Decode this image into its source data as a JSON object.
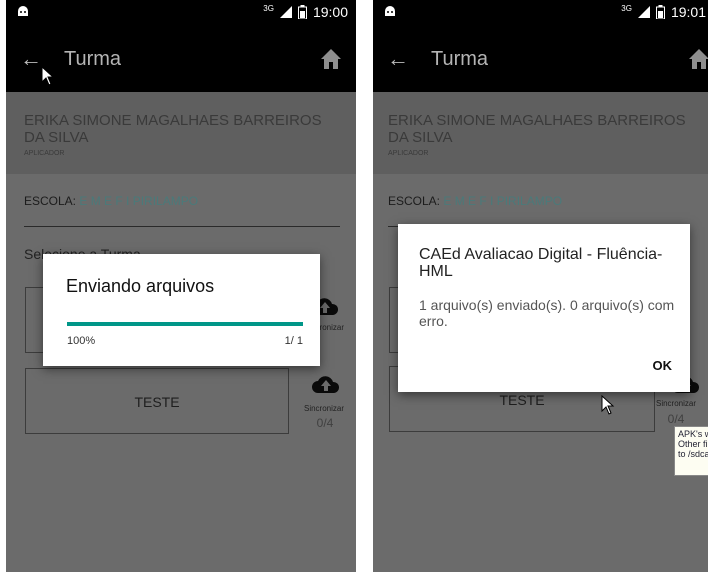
{
  "screens": [
    {
      "status_time": "19:00",
      "status_network": "3G",
      "title": "Turma",
      "user_name": "ERIKA SIMONE MAGALHAES BARREIROS DA SILVA",
      "user_role": "APLICADOR",
      "escola_label": "ESCOLA:",
      "escola_value": "E M E F I PIRILAMPO",
      "select_label": "Selecione a Turma",
      "turmas": [
        {
          "label": "",
          "sync_label": "Sincronizar",
          "sync_count": "0/4"
        },
        {
          "label": "TESTE",
          "sync_label": "Sincronizar",
          "sync_count": "0/4"
        }
      ],
      "progress_dialog": {
        "title": "Enviando arquivos",
        "percent_label": "100%",
        "count_label": "1/ 1",
        "progress": 1.0
      }
    },
    {
      "status_time": "19:01",
      "status_network": "3G",
      "title": "Turma",
      "user_name": "ERIKA SIMONE MAGALHAES BARREIROS DA SILVA",
      "user_role": "APLICADOR",
      "escola_label": "ESCOLA:",
      "escola_value": "E M E F I PIRILAMPO",
      "turmas": [
        {
          "label": "",
          "sync_label": "Sincronizar",
          "sync_count": ""
        },
        {
          "label": "TESTE",
          "sync_label": "Sincronizar",
          "sync_count": "0/4"
        }
      ],
      "alert_dialog": {
        "title": "CAEd Avaliacao Digital - Fluência-HML",
        "message": "1 arquivo(s) enviado(s). 0 arquivo(s) com erro.",
        "ok_label": "OK"
      },
      "tooltip": [
        "APK's w",
        "Other fi",
        "to /sdca"
      ]
    }
  ],
  "colors": {
    "appbar": "#000000",
    "screen_dim": "#6b6b6b",
    "progress": "#009688"
  }
}
